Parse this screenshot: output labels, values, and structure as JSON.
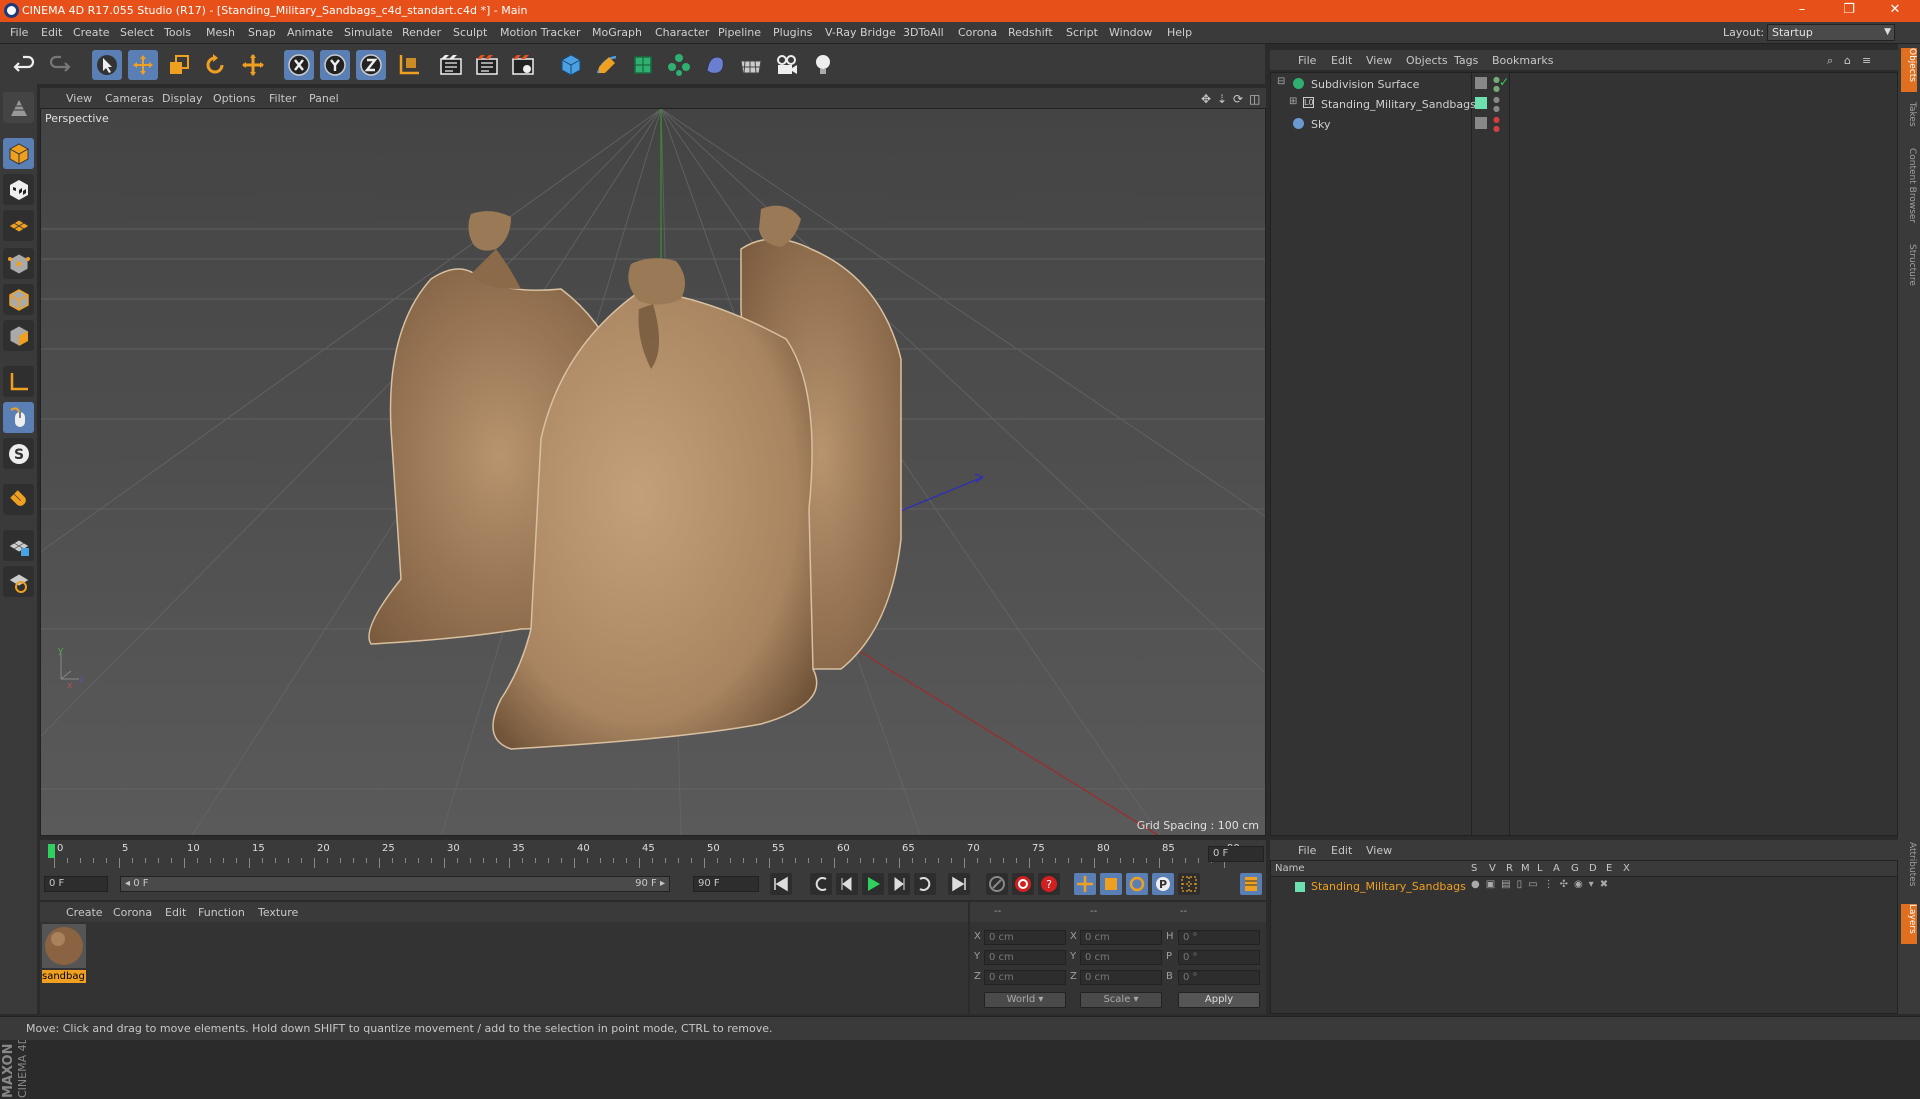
{
  "window": {
    "title": "CINEMA 4D R17.055 Studio (R17) - [Standing_Military_Sandbags_c4d_standart.c4d *] - Main",
    "controls": [
      "–",
      "❐",
      "✕"
    ]
  },
  "menubar": {
    "items": [
      "File",
      "Edit",
      "Create",
      "Select",
      "Tools",
      "Mesh",
      "Snap",
      "Animate",
      "Simulate",
      "Render",
      "Sculpt",
      "Motion Tracker",
      "MoGraph",
      "Character",
      "Pipeline",
      "Plugins",
      "V-Ray Bridge",
      "3DToAll",
      "Corona",
      "Redshift",
      "Script",
      "Window",
      "Help"
    ],
    "layout_label": "Layout:",
    "layout_value": "Startup"
  },
  "toolbar": {
    "icons": [
      "undo-icon",
      "redo-icon",
      "select-arrow-icon",
      "move-icon",
      "scale-icon",
      "rotate-icon",
      "transform-icon",
      "x-axis-icon",
      "y-axis-icon",
      "z-axis-icon",
      "world-coord-icon",
      "render-view-icon",
      "render-picture-viewer-icon",
      "render-settings-icon",
      "cube-icon",
      "pen-icon",
      "subdivision-icon",
      "array-icon",
      "deformer-icon",
      "floor-icon",
      "camera-icon",
      "light-icon"
    ]
  },
  "viewport": {
    "menu": [
      "View",
      "Cameras",
      "Display",
      "Options",
      "Filter",
      "Panel"
    ],
    "label": "Perspective",
    "grid_spacing": "Grid Spacing : 100 cm"
  },
  "timeline": {
    "ticks": [
      "0",
      "5",
      "10",
      "15",
      "20",
      "25",
      "30",
      "35",
      "40",
      "45",
      "50",
      "55",
      "60",
      "65",
      "70",
      "75",
      "80",
      "85",
      "90"
    ],
    "current_frame": "0 F",
    "start_field": "0 F",
    "range_start": "◂ 0 F",
    "range_end": "90 F ▸",
    "end_field": "90 F"
  },
  "material_manager": {
    "menu": [
      "Create",
      "Corona",
      "Edit",
      "Function",
      "Texture"
    ],
    "material_name": "sandbag"
  },
  "coordinates": {
    "headers": [
      "--",
      "--",
      "--"
    ],
    "rows": [
      {
        "axis": "X",
        "pos": "0 cm",
        "axis2": "X",
        "size": "0 cm",
        "rot_label": "H",
        "rot": "0 °"
      },
      {
        "axis": "Y",
        "pos": "0 cm",
        "axis2": "Y",
        "size": "0 cm",
        "rot_label": "P",
        "rot": "0 °"
      },
      {
        "axis": "Z",
        "pos": "0 cm",
        "axis2": "Z",
        "size": "0 cm",
        "rot_label": "B",
        "rot": "0 °"
      }
    ],
    "mode1": "World",
    "mode2": "Scale",
    "apply": "Apply"
  },
  "object_manager": {
    "menu": [
      "File",
      "Edit",
      "View",
      "Objects",
      "Tags",
      "Bookmarks"
    ],
    "objects": [
      {
        "name": "Subdivision Surface",
        "indent": 0
      },
      {
        "name": "Standing_Military_Sandbags",
        "indent": 1
      },
      {
        "name": "Sky",
        "indent": 0
      }
    ]
  },
  "layer_manager": {
    "menu": [
      "File",
      "Edit",
      "View"
    ],
    "columns": [
      "Name",
      "S",
      "V",
      "R",
      "M",
      "L",
      "A",
      "G",
      "D",
      "E",
      "X"
    ],
    "layer_name": "Standing_Military_Sandbags"
  },
  "side_tabs": [
    "Objects",
    "Takes",
    "Content Browser",
    "Structure",
    "Attributes",
    "Layers"
  ],
  "status": "Move: Click and drag to move elements. Hold down SHIFT to quantize movement / add to the selection in point mode, CTRL to remove.",
  "colors": {
    "title_bar": "#e8501a",
    "accent": "#f0a020",
    "selected": "#5a7fb5"
  }
}
